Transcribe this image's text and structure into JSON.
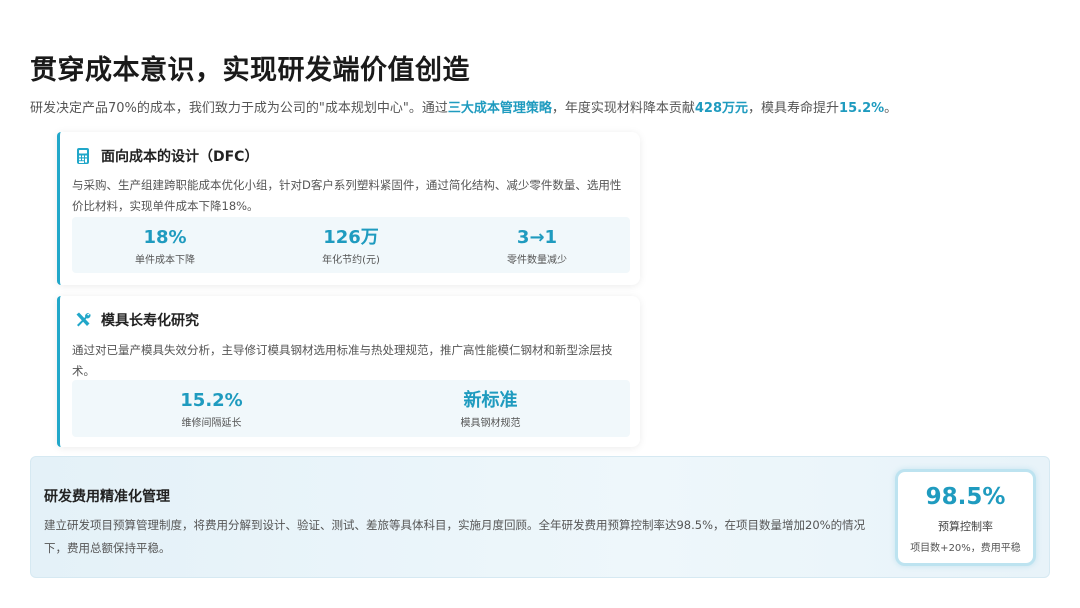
{
  "header": {
    "title": "贯穿成本意识，实现研发端价值创造",
    "subtitle_parts": [
      "研发决定产品70%的成本，我们致力于成为公司的\"成本规划中心\"。通过",
      "三大成本管理策略",
      "，年度实现材料降本贡献",
      "428万元",
      "，模具寿命提升",
      "15.2%",
      "。"
    ]
  },
  "card_dfc": {
    "icon": "calculator-icon",
    "title": "面向成本的设计（DFC）",
    "desc": "与采购、生产组建跨职能成本优化小组，针对D客户系列塑料紧固件，通过简化结构、减少零件数量、选用性价比材料，实现单件成本下降18%。",
    "stats": [
      {
        "value": "18%",
        "label": "单件成本下降"
      },
      {
        "value": "126万",
        "label": "年化节约(元)"
      },
      {
        "value": "3→1",
        "label": "零件数量减少"
      }
    ]
  },
  "card_mold": {
    "icon": "tools-icon",
    "title": "模具长寿化研究",
    "desc": "通过对已量产模具失效分析，主导修订模具钢材选用标准与热处理规范，推广高性能模仁钢材和新型涂层技术。",
    "stats": [
      {
        "value": "15.2%",
        "label": "维修间隔延长"
      },
      {
        "value": "新标准",
        "label": "模具钢材规范"
      }
    ]
  },
  "budget": {
    "title": "研发费用精准化管理",
    "desc": "建立研发项目预算管理制度，将费用分解到设计、验证、测试、差旅等具体科目，实施月度回顾。全年研发费用预算控制率达98.5%，在项目数量增加20%的情况下，费用总额保持平稳。",
    "kpi_value": "98.5%",
    "kpi_label": "预算控制率",
    "kpi_sub": "项目数+20%，费用平稳"
  },
  "colors": {
    "accent": "#1f9bbf",
    "card_border": "#21a7c9"
  }
}
